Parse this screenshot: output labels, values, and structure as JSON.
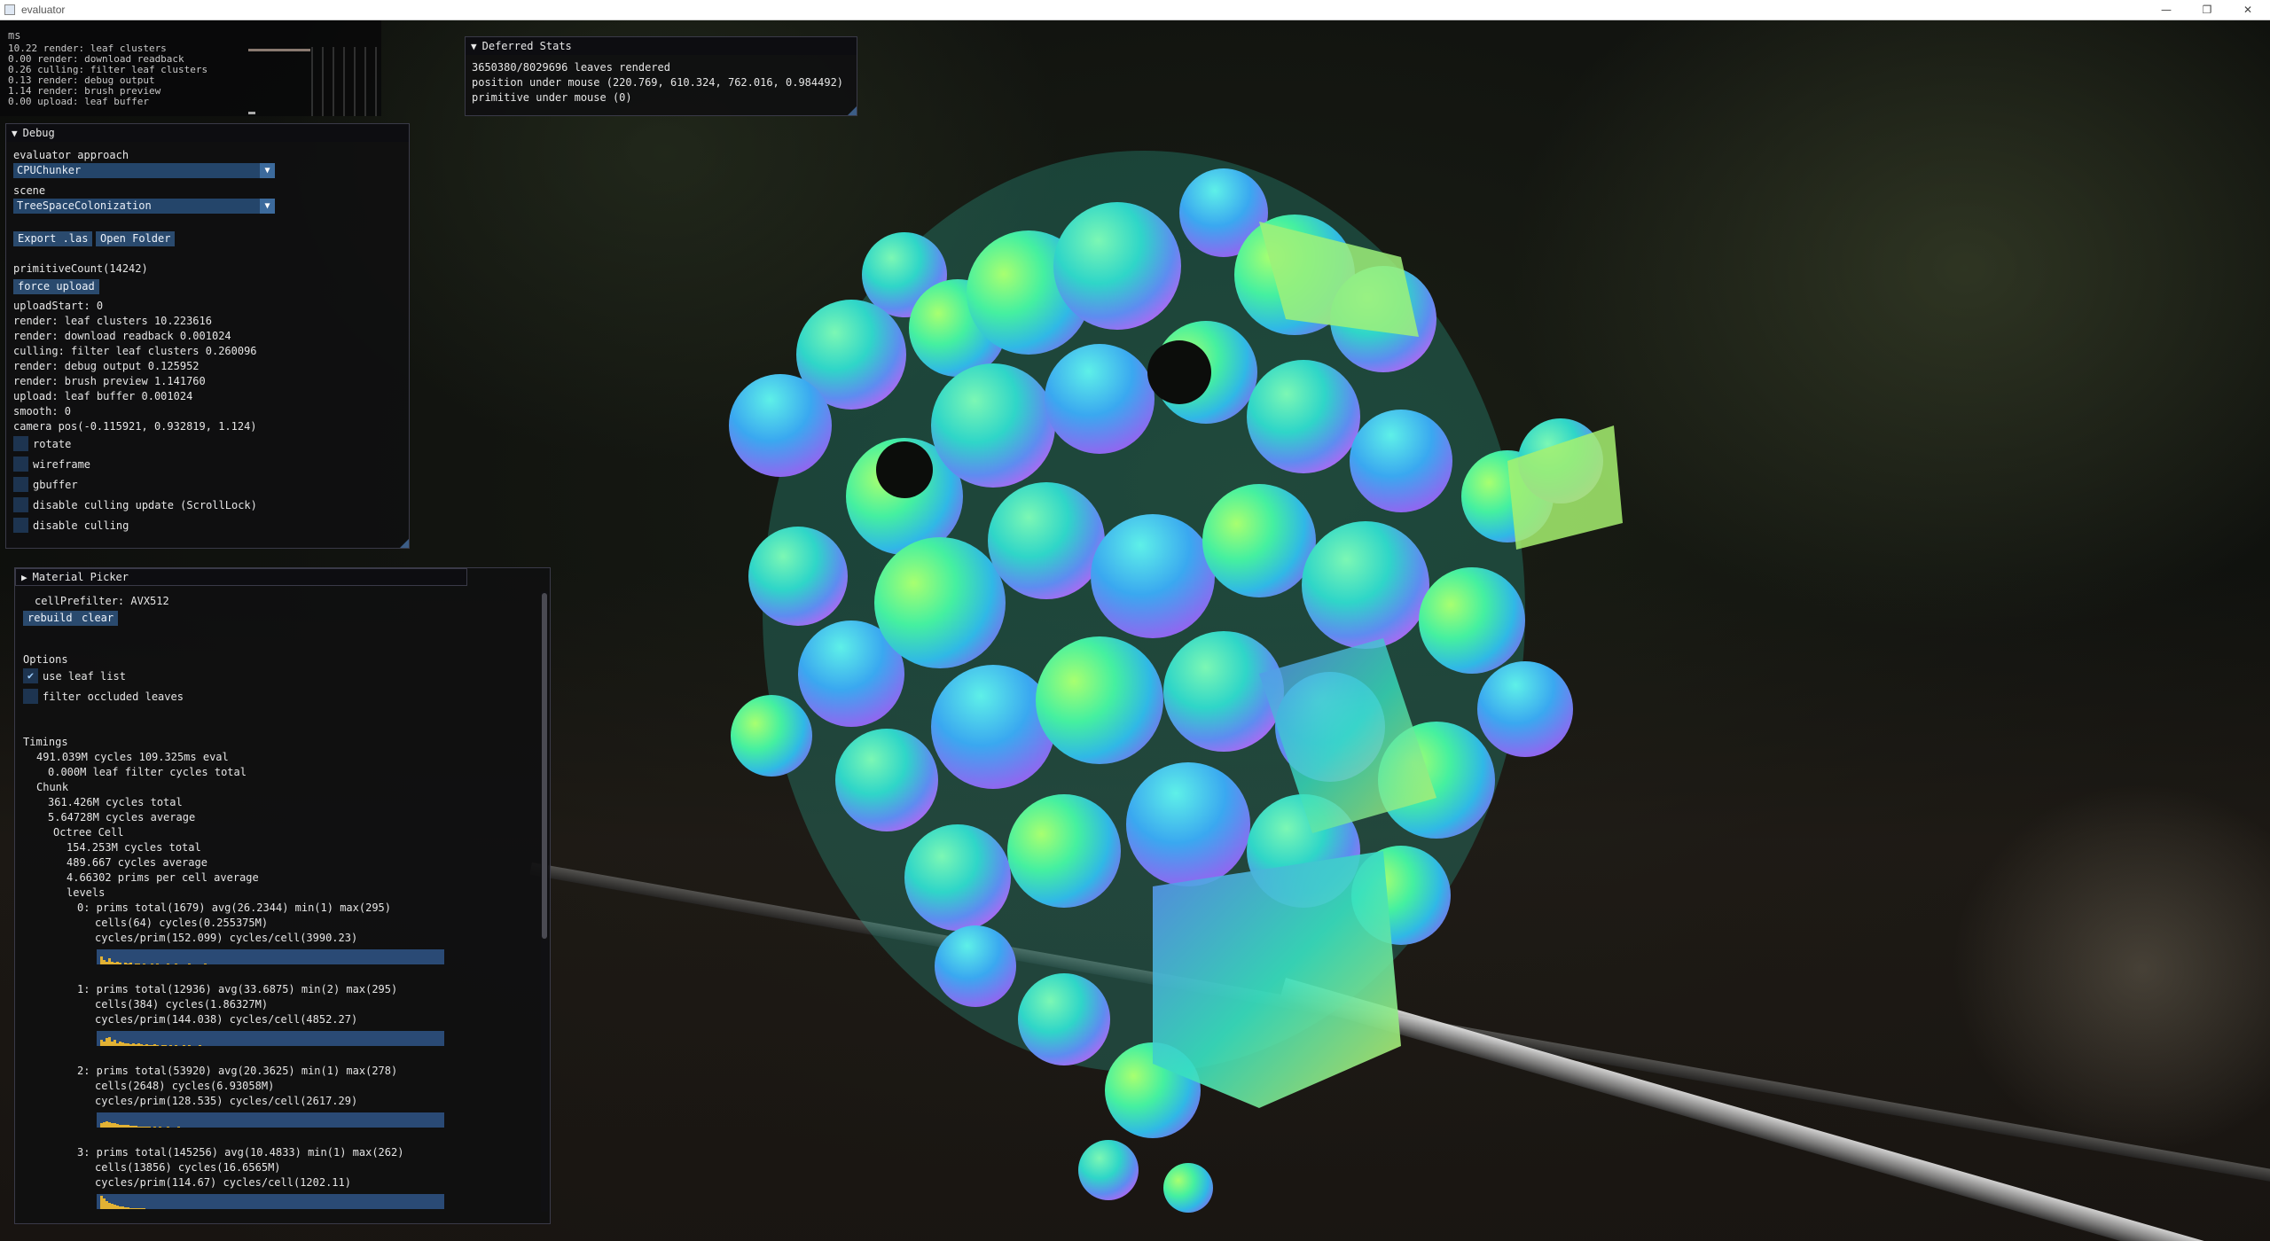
{
  "window": {
    "title": "evaluator",
    "minimize": "—",
    "restore": "❐",
    "close": "✕"
  },
  "perf_overlay": {
    "header": "ms",
    "lines": [
      "10.22 render: leaf clusters",
      "0.00 render: download readback",
      "0.26 culling: filter leaf clusters",
      "0.13 render: debug output",
      "1.14 render: brush preview",
      "0.00 upload: leaf buffer"
    ]
  },
  "deferred_stats": {
    "title": "Deferred Stats",
    "leaves": "3650380/8029696 leaves rendered",
    "position": "position under mouse (220.769, 610.324, 762.016, 0.984492)",
    "primitive": "primitive under mouse (0)"
  },
  "debug": {
    "title": "Debug",
    "approach_label": "evaluator approach",
    "approach_value": "CPUChunker",
    "scene_label": "scene",
    "scene_value": "TreeSpaceColonization",
    "export_button": "Export .las",
    "open_folder_button": "Open Folder",
    "primitive_count": "primitiveCount(14242)",
    "force_upload_button": "force upload",
    "stats": [
      "uploadStart: 0",
      "render: leaf clusters 10.223616",
      "render: download readback 0.001024",
      "culling: filter leaf clusters 0.260096",
      "render: debug output 0.125952",
      "render: brush preview 1.141760",
      "upload: leaf buffer 0.001024",
      "smooth: 0",
      "camera pos(-0.115921, 0.932819, 1.124)"
    ],
    "checkboxes": [
      {
        "label": "rotate",
        "checked": false
      },
      {
        "label": "wireframe",
        "checked": false
      },
      {
        "label": "gbuffer",
        "checked": false
      },
      {
        "label": "disable culling update (ScrollLock)",
        "checked": false
      },
      {
        "label": "disable culling",
        "checked": false
      }
    ]
  },
  "material_picker": {
    "title": "Material Picker",
    "cell_prefilter": "cellPrefilter: AVX512",
    "rebuild_button": "rebuild",
    "clear_button": "clear",
    "options_label": "Options",
    "use_leaf_list": {
      "label": "use leaf list",
      "checked": true
    },
    "filter_occluded": {
      "label": "filter occluded leaves",
      "checked": false
    },
    "timings_label": "Timings",
    "timing_lines": [
      "491.039M cycles 109.325ms eval",
      "0.000M leaf filter cycles total",
      "Chunk",
      "361.426M cycles total",
      "5.64728M cycles average",
      "Octree Cell",
      "154.253M cycles total",
      "489.667 cycles average",
      "4.66302 prims per cell average",
      "levels"
    ],
    "levels": [
      {
        "line1": "0: prims total(1679) avg(26.2344) min(1) max(295)",
        "line2": "cells(64) cycles(0.255375M)",
        "line3": "cycles/prim(152.099) cycles/cell(3990.23)",
        "histogram": [
          0.5,
          0.3,
          0.2,
          0.4,
          0.2,
          0.1,
          0.15,
          0.1,
          0,
          0.1,
          0.05,
          0.1,
          0,
          0.05,
          0.05,
          0,
          0.05,
          0,
          0,
          0.05,
          0,
          0.05,
          0,
          0,
          0,
          0.05,
          0,
          0,
          0.05,
          0,
          0,
          0,
          0,
          0.05,
          0,
          0,
          0,
          0,
          0,
          0.05
        ]
      },
      {
        "line1": "1: prims total(12936) avg(33.6875) min(2) max(295)",
        "line2": "cells(384) cycles(1.86327M)",
        "line3": "cycles/prim(144.038) cycles/cell(4852.27)",
        "histogram": [
          0.4,
          0.3,
          0.5,
          0.6,
          0.3,
          0.4,
          0.2,
          0.3,
          0.25,
          0.2,
          0.15,
          0.1,
          0.2,
          0.1,
          0.15,
          0.1,
          0.05,
          0.1,
          0.05,
          0.05,
          0.1,
          0.05,
          0,
          0.05,
          0.05,
          0,
          0.05,
          0,
          0.05,
          0,
          0,
          0.05,
          0,
          0.05,
          0,
          0,
          0,
          0.05,
          0,
          0
        ]
      },
      {
        "line1": "2: prims total(53920) avg(20.3625) min(1) max(278)",
        "line2": "cells(2648) cycles(6.93058M)",
        "line3": "cycles/prim(128.535) cycles/cell(2617.29)",
        "histogram": [
          0.3,
          0.35,
          0.4,
          0.35,
          0.3,
          0.3,
          0.25,
          0.2,
          0.2,
          0.15,
          0.15,
          0.1,
          0.1,
          0.1,
          0.05,
          0.05,
          0.05,
          0.05,
          0.05,
          0,
          0.05,
          0,
          0.05,
          0,
          0,
          0.05,
          0,
          0,
          0,
          0.05,
          0,
          0,
          0,
          0,
          0,
          0,
          0,
          0,
          0,
          0
        ]
      },
      {
        "line1": "3: prims total(145256) avg(10.4833) min(1) max(262)",
        "line2": "cells(13856) cycles(16.6565M)",
        "line3": "cycles/prim(114.67) cycles/cell(1202.11)",
        "histogram": [
          0.9,
          0.7,
          0.5,
          0.4,
          0.35,
          0.3,
          0.25,
          0.2,
          0.15,
          0.1,
          0.1,
          0.08,
          0.05,
          0.05,
          0.05,
          0.03,
          0.03,
          0.02,
          0.02,
          0.02,
          0,
          0,
          0,
          0,
          0,
          0,
          0,
          0,
          0,
          0,
          0,
          0,
          0,
          0,
          0,
          0,
          0,
          0,
          0,
          0
        ]
      }
    ]
  },
  "colors": {
    "button": "#2a4a6e",
    "histogram_bar": "#e2b234",
    "panel_border": "#3a3a48"
  }
}
